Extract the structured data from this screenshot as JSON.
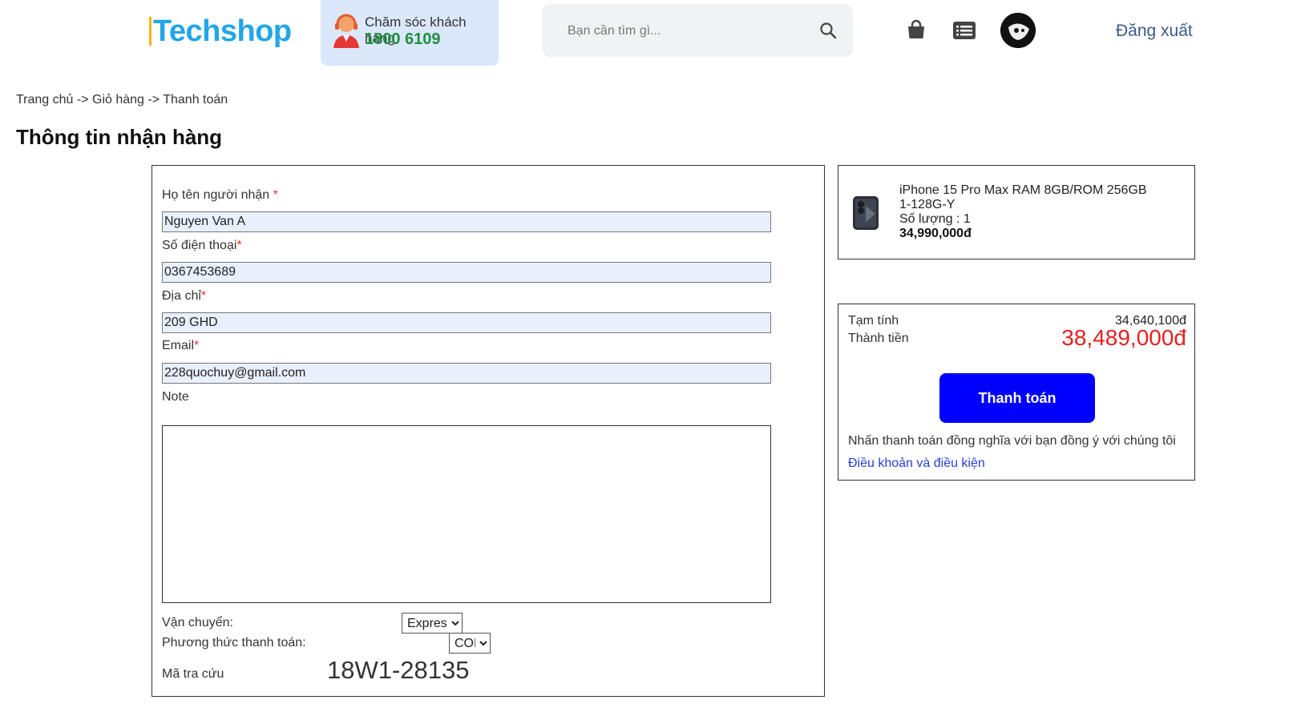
{
  "header": {
    "logo": "Techshop",
    "support_label": "Chăm sóc khách hàng",
    "support_phone": "1800 6109",
    "search_placeholder": "Bạn cần tìm gì...",
    "logout": "Đăng xuất",
    "icons": [
      "headset-agent-icon",
      "search-icon",
      "shopping-bag-icon",
      "order-list-icon",
      "avatar"
    ]
  },
  "breadcrumb": "Trang chủ -> Giỏ hàng -> Thanh toán",
  "page_title": "Thông tin nhận hàng",
  "form": {
    "name_label": "Họ tên người nhận",
    "name_value": "Nguyen Van A",
    "phone_label": "Số điện thoại",
    "phone_value": "0367453689",
    "address_label": "Địa chỉ",
    "address_value": "209 GHD",
    "email_label": "Email",
    "email_value": "228quochuy@gmail.com",
    "note_label": "Note",
    "note_value": "",
    "required_mark": "*",
    "shipping_label": "Vận chuyển:",
    "shipping_value": "Express",
    "payment_label": "Phương thức thanh toán:",
    "payment_value": "COD",
    "lookup_label": "Mã tra cứu",
    "lookup_code": "18W1-28135"
  },
  "product": {
    "name": "iPhone 15 Pro Max RAM 8GB/ROM 256GB",
    "sku": "1-128G-Y",
    "quantity": "Số lượng : 1",
    "price": "34,990,000đ"
  },
  "summary": {
    "subtotal_label": "Tạm tính",
    "subtotal_value": "34,640,100đ",
    "total_label": "Thành tiền",
    "total_value": "38,489,000đ",
    "pay_button": "Thanh toán",
    "agree_text": "Nhấn thanh toán đồng nghĩa với bạn đồng ý với chúng tôi",
    "terms_link": "Điều khoản và điều kiện"
  },
  "colors": {
    "brand": "#22a6e8",
    "support_bg": "#dbe7fb",
    "phone": "#1e8e3e",
    "total": "#e62020",
    "pay_button": "#0000ff",
    "link": "#2a3ddb"
  }
}
